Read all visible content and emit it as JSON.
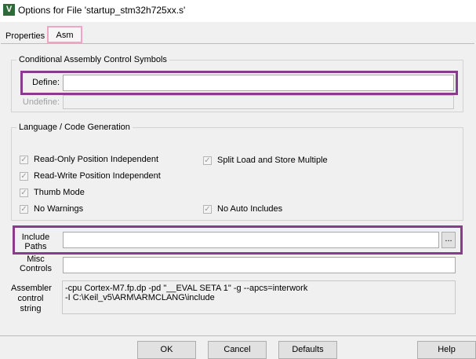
{
  "window": {
    "title": "Options for File 'startup_stm32h725xx.s'",
    "icon_letter": "V"
  },
  "tabs": [
    {
      "label": "Properties"
    },
    {
      "label": "Asm"
    }
  ],
  "conditional": {
    "legend": "Conditional Assembly Control Symbols",
    "define_label": "Define:",
    "define_value": "",
    "undefine_label": "Undefine:",
    "undefine_value": ""
  },
  "language": {
    "legend": "Language / Code Generation",
    "options": [
      {
        "label": "Read-Only Position Independent",
        "checked": true
      },
      {
        "label": "Split Load and Store Multiple",
        "checked": true
      },
      {
        "label": "Read-Write Position Independent",
        "checked": true
      },
      {
        "label": "Thumb Mode",
        "checked": true
      },
      {
        "label": "No Warnings",
        "checked": true
      },
      {
        "label": "No Auto Includes",
        "checked": true
      }
    ]
  },
  "include": {
    "label_line1": "Include",
    "label_line2": "Paths",
    "value": "",
    "browse_label": "..."
  },
  "misc": {
    "label_line1": "Misc",
    "label_line2": "Controls",
    "value": ""
  },
  "assembler": {
    "label_line1": "Assembler",
    "label_line2": "control",
    "label_line3": "string",
    "line1": "-cpu Cortex-M7.fp.dp -pd \"__EVAL SETA 1\" -g --apcs=interwork",
    "line2": "-I C:\\Keil_v5\\ARM\\ARMCLANG\\include"
  },
  "buttons": {
    "ok": "OK",
    "cancel": "Cancel",
    "defaults": "Defaults",
    "help": "Help"
  },
  "colors": {
    "highlight_purple": "#8a3c8c",
    "highlight_pink": "#f3a4c4"
  }
}
